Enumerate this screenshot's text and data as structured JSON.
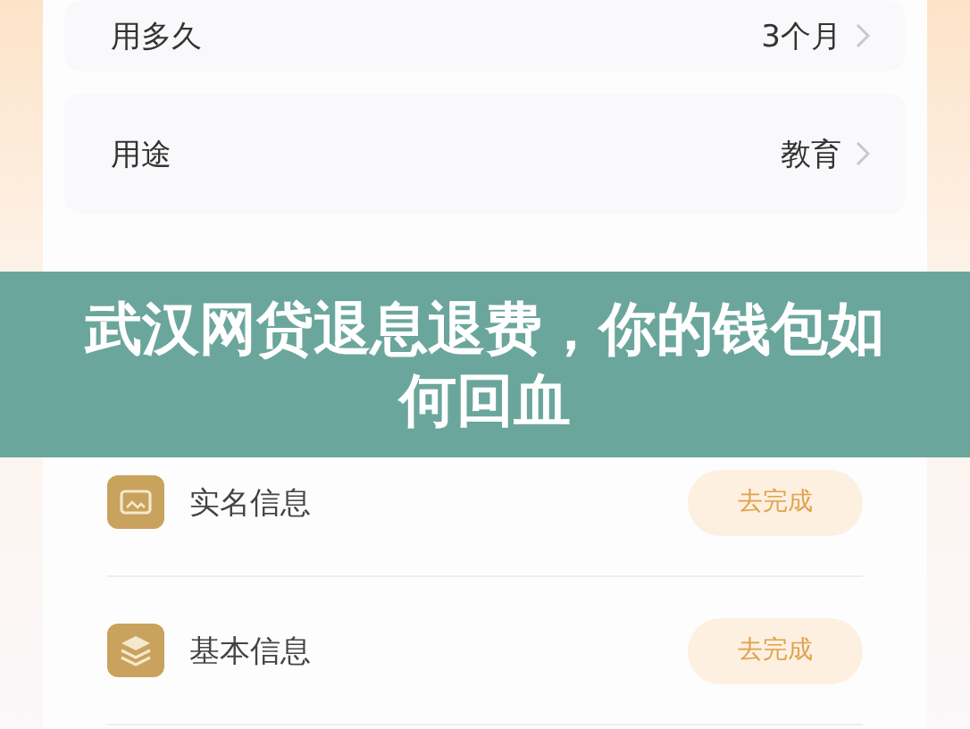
{
  "loan_options": [
    {
      "label": "用多久",
      "value": "3个月"
    },
    {
      "label": "用途",
      "value": "教育"
    }
  ],
  "tasks": [
    {
      "kind": "id",
      "label": "实名信息",
      "action": "去完成"
    },
    {
      "kind": "basic",
      "label": "基本信息",
      "action": "去完成"
    }
  ],
  "banner": {
    "title": "武汉网贷退息退费，你的钱包如何回血"
  }
}
